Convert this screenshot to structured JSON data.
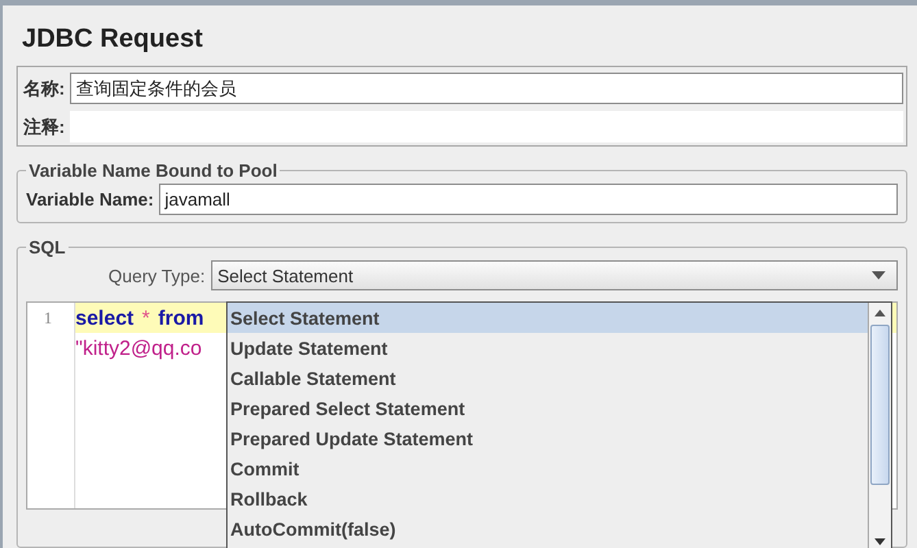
{
  "title": "JDBC Request",
  "name_field": {
    "label": "名称:",
    "value": "查询固定条件的会员"
  },
  "comment_field": {
    "label": "注释:"
  },
  "pool_group": {
    "title": "Variable Name Bound to Pool",
    "label": "Variable Name:",
    "value": "javamall"
  },
  "sql_group": {
    "title": "SQL",
    "query_type": {
      "label": "Query Type:",
      "value": "Select Statement"
    }
  },
  "editor": {
    "lines": [
      {
        "number": "1",
        "current": true,
        "tokens": [
          {
            "text": "select",
            "kind": "keyword"
          },
          {
            "text": "*",
            "kind": "operator"
          },
          {
            "text": "from",
            "kind": "keyword"
          }
        ]
      },
      {
        "current": false,
        "tokens": [
          {
            "text": "\"kitty2@qq.co",
            "kind": "string"
          }
        ]
      }
    ]
  },
  "dropdown_options": [
    {
      "label": "Select Statement",
      "selected": true
    },
    {
      "label": "Update Statement",
      "selected": false
    },
    {
      "label": "Callable Statement",
      "selected": false
    },
    {
      "label": "Prepared Select Statement",
      "selected": false
    },
    {
      "label": "Prepared Update Statement",
      "selected": false
    },
    {
      "label": "Commit",
      "selected": false
    },
    {
      "label": "Rollback",
      "selected": false
    },
    {
      "label": "AutoCommit(false)",
      "selected": false
    }
  ]
}
